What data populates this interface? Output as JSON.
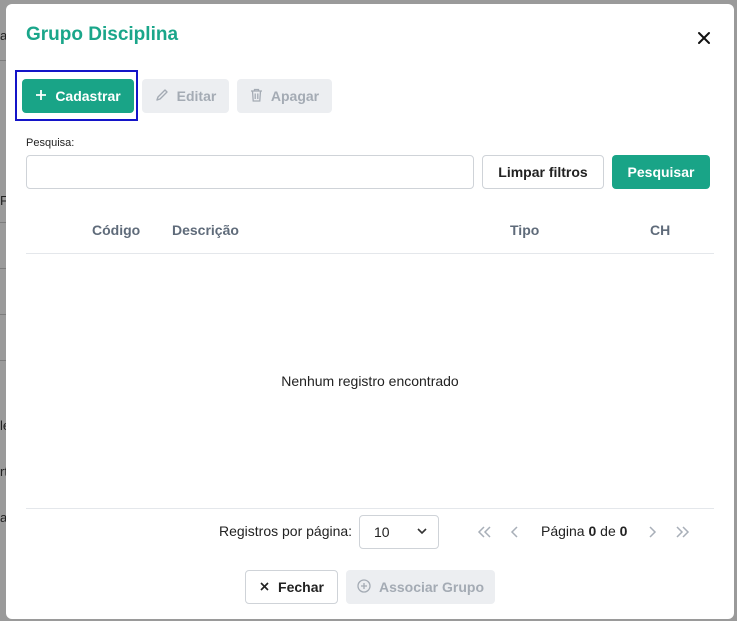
{
  "background": {
    "fragments": [
      "a",
      "F",
      "le",
      "rt",
      "a"
    ]
  },
  "modal": {
    "title": "Grupo Disciplina",
    "toolbar": {
      "create_label": "Cadastrar",
      "edit_label": "Editar",
      "delete_label": "Apagar"
    },
    "search": {
      "label": "Pesquisa:",
      "value": "",
      "placeholder": "",
      "clear_label": "Limpar filtros",
      "search_label": "Pesquisar"
    },
    "table": {
      "columns": [
        "Código",
        "Descrição",
        "Tipo",
        "CH"
      ],
      "empty_message": "Nenhum registro encontrado"
    },
    "pagination": {
      "rows_label": "Registros por página:",
      "rows_value": "10",
      "page_prefix": "Página",
      "current_page": "0",
      "of_label": "de",
      "total_pages": "0"
    },
    "footer": {
      "close_label": "Fechar",
      "associate_label": "Associar Grupo"
    }
  },
  "colors": {
    "accent": "#19a487",
    "title": "#1aa68a",
    "highlight_border": "#1414c8",
    "disabled_bg": "#eceef1",
    "disabled_text": "#a4abb4"
  },
  "icons": {
    "close": "close-icon",
    "plus": "plus-icon",
    "edit": "pencil-icon",
    "delete": "trash-icon",
    "dropdown": "chevron-down-icon",
    "first": "double-chevron-left-icon",
    "prev": "chevron-left-icon",
    "next": "chevron-right-icon",
    "last": "double-chevron-right-icon",
    "associate": "plus-circle-icon"
  }
}
